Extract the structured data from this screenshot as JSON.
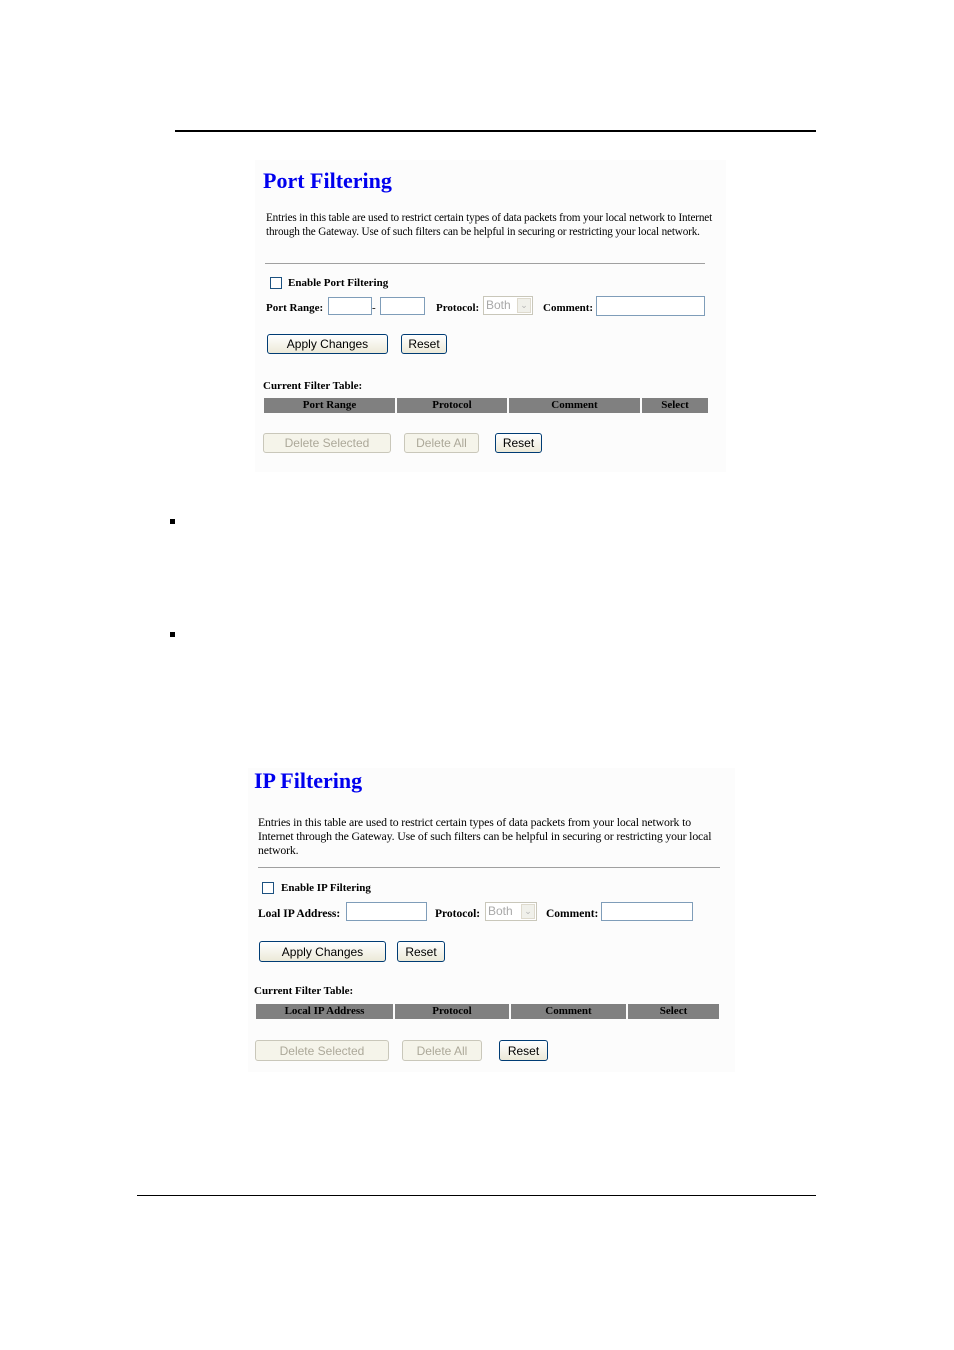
{
  "port_filtering": {
    "title": "Port Filtering",
    "description": "Entries in this table are used to restrict certain types of data packets from your local network to Internet through the Gateway. Use of such filters can be helpful in securing or restricting your local network.",
    "enable_label": "Enable Port Filtering",
    "enable_checked": false,
    "port_range_label": "Port Range:",
    "range_separator": "-",
    "port_from_value": "",
    "port_to_value": "",
    "protocol_label": "Protocol:",
    "protocol_selected": "Both",
    "comment_label": "Comment:",
    "comment_value": "",
    "apply_label": "Apply Changes",
    "reset_label": "Reset",
    "table_title": "Current Filter Table:",
    "columns": [
      "Port Range",
      "Protocol",
      "Comment",
      "Select"
    ],
    "rows": [],
    "delete_selected_label": "Delete Selected",
    "delete_all_label": "Delete All",
    "table_reset_label": "Reset"
  },
  "ip_filtering": {
    "title": "IP Filtering",
    "description": "Entries in this table are used to restrict certain types of data packets from your local network to Internet through the Gateway. Use of such filters can be helpful in securing or restricting your local network.",
    "enable_label": "Enable IP Filtering",
    "enable_checked": false,
    "ip_label": "Loal IP Address:",
    "ip_value": "",
    "protocol_label": "Protocol:",
    "protocol_selected": "Both",
    "comment_label": "Comment:",
    "comment_value": "",
    "apply_label": "Apply Changes",
    "reset_label": "Reset",
    "table_title": "Current Filter Table:",
    "columns": [
      "Local IP Address",
      "Protocol",
      "Comment",
      "Select"
    ],
    "rows": [],
    "delete_selected_label": "Delete Selected",
    "delete_all_label": "Delete All",
    "table_reset_label": "Reset"
  },
  "colors": {
    "title": "#0000ee",
    "table_header_bg": "#808080"
  }
}
